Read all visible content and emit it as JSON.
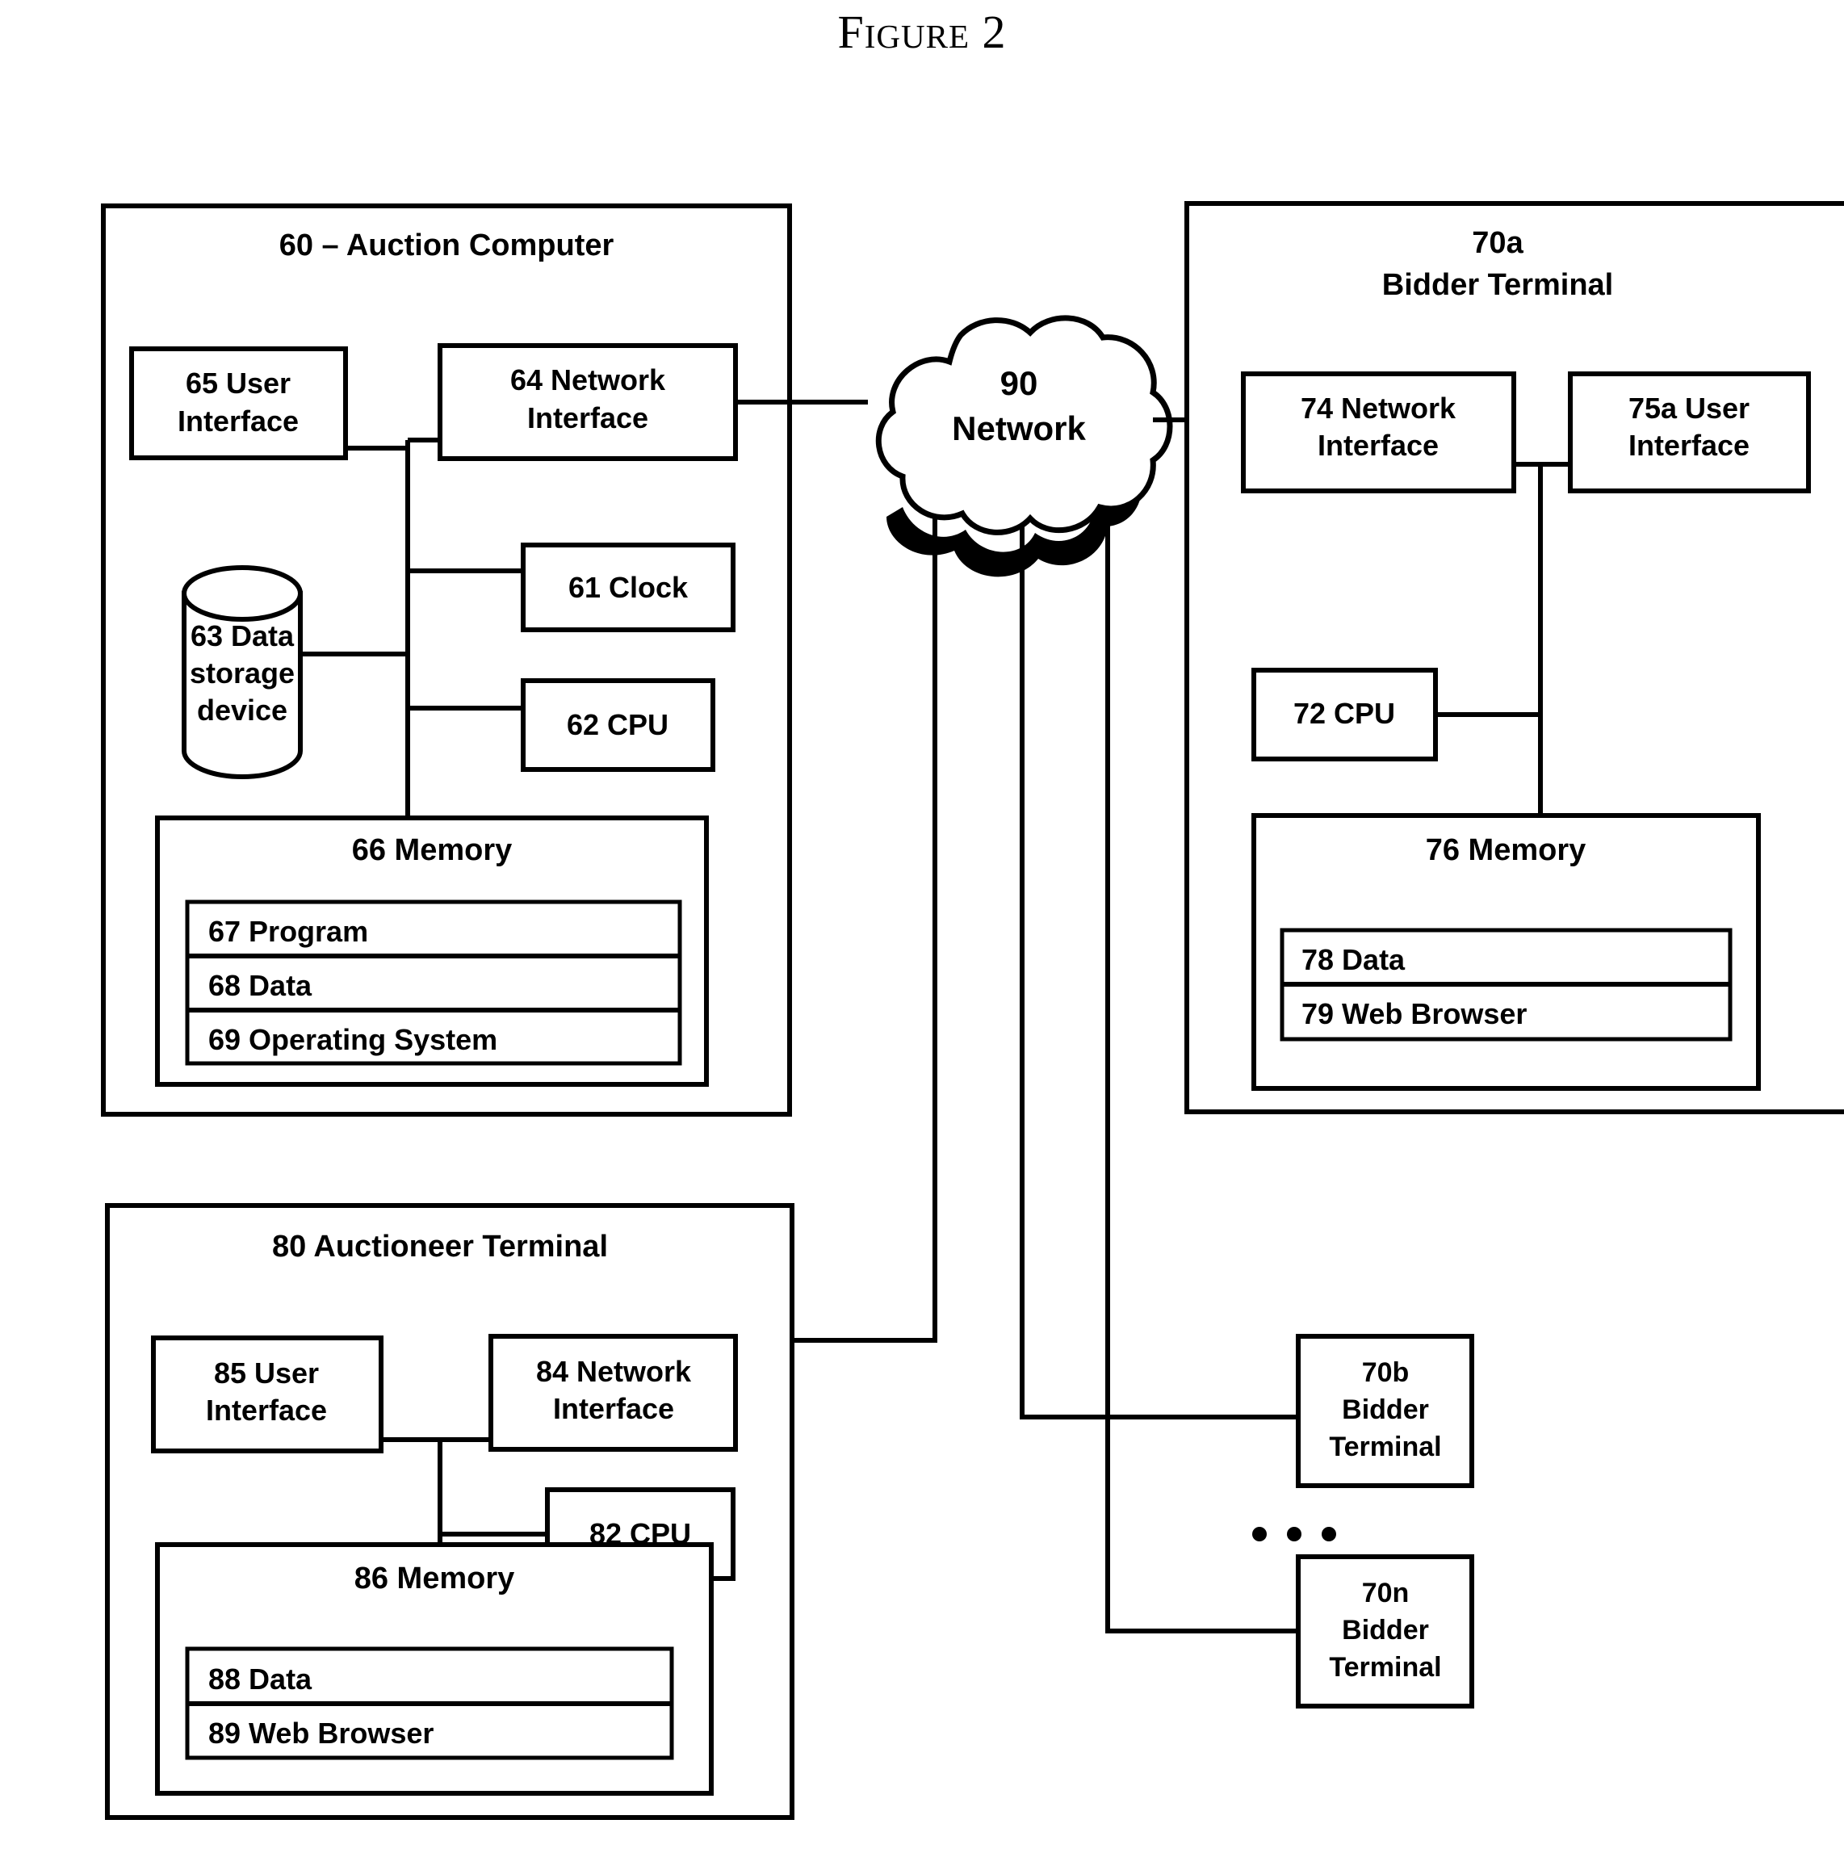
{
  "figure": {
    "title": "Figure 2"
  },
  "auction_computer": {
    "title": "60 – Auction Computer",
    "user_interface": "65  User\nInterface",
    "user_interface_line1": "65  User",
    "user_interface_line2": "Interface",
    "network_interface_line1": "64  Network",
    "network_interface_line2": "Interface",
    "clock": "61   Clock",
    "cpu": "62   CPU",
    "data_storage_line1": "63  Data",
    "data_storage_line2": "storage",
    "data_storage_line3": "device",
    "memory_title": "66  Memory",
    "memory_rows": [
      "67  Program",
      "68  Data",
      "69  Operating System"
    ]
  },
  "network": {
    "label_line1": "90",
    "label_line2": "Network"
  },
  "bidder_terminal_a": {
    "title_line1": "70a",
    "title_line2": "Bidder Terminal",
    "network_interface_line1": "74  Network",
    "network_interface_line2": "Interface",
    "user_interface_line1": "75a  User",
    "user_interface_line2": "Interface",
    "cpu": "72 CPU",
    "memory_title": "76 Memory",
    "memory_rows": [
      "78  Data",
      "79  Web Browser"
    ]
  },
  "auctioneer_terminal": {
    "title": "80  Auctioneer Terminal",
    "user_interface_line1": "85 User",
    "user_interface_line2": "Interface",
    "network_interface_line1": "84 Network",
    "network_interface_line2": "Interface",
    "cpu": "82 CPU",
    "memory_title": "86 Memory",
    "memory_rows": [
      "88  Data",
      "89  Web Browser"
    ]
  },
  "bidder_terminal_b": {
    "line1": "70b",
    "line2": "Bidder",
    "line3": "Terminal"
  },
  "bidder_terminal_n": {
    "line1": "70n",
    "line2": "Bidder",
    "line3": "Terminal"
  },
  "ellipsis": {
    "label": "•  •  •"
  },
  "colors": {
    "ink": "#000000",
    "paper": "#ffffff"
  }
}
